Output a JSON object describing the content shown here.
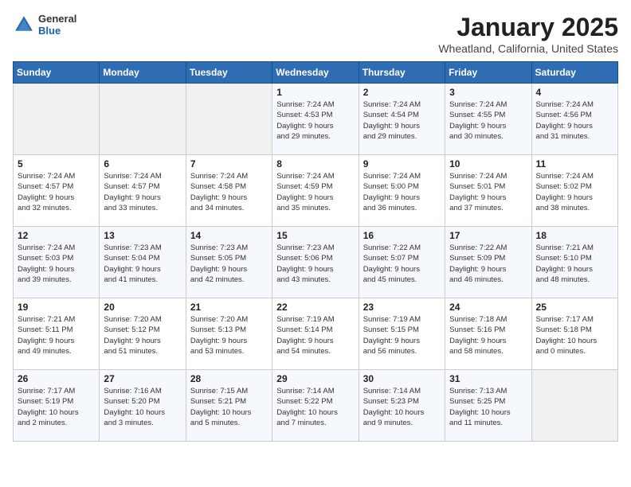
{
  "logo": {
    "general": "General",
    "blue": "Blue"
  },
  "header": {
    "title": "January 2025",
    "location": "Wheatland, California, United States"
  },
  "weekdays": [
    "Sunday",
    "Monday",
    "Tuesday",
    "Wednesday",
    "Thursday",
    "Friday",
    "Saturday"
  ],
  "weeks": [
    [
      {
        "day": "",
        "info": ""
      },
      {
        "day": "",
        "info": ""
      },
      {
        "day": "",
        "info": ""
      },
      {
        "day": "1",
        "info": "Sunrise: 7:24 AM\nSunset: 4:53 PM\nDaylight: 9 hours\nand 29 minutes."
      },
      {
        "day": "2",
        "info": "Sunrise: 7:24 AM\nSunset: 4:54 PM\nDaylight: 9 hours\nand 29 minutes."
      },
      {
        "day": "3",
        "info": "Sunrise: 7:24 AM\nSunset: 4:55 PM\nDaylight: 9 hours\nand 30 minutes."
      },
      {
        "day": "4",
        "info": "Sunrise: 7:24 AM\nSunset: 4:56 PM\nDaylight: 9 hours\nand 31 minutes."
      }
    ],
    [
      {
        "day": "5",
        "info": "Sunrise: 7:24 AM\nSunset: 4:57 PM\nDaylight: 9 hours\nand 32 minutes."
      },
      {
        "day": "6",
        "info": "Sunrise: 7:24 AM\nSunset: 4:57 PM\nDaylight: 9 hours\nand 33 minutes."
      },
      {
        "day": "7",
        "info": "Sunrise: 7:24 AM\nSunset: 4:58 PM\nDaylight: 9 hours\nand 34 minutes."
      },
      {
        "day": "8",
        "info": "Sunrise: 7:24 AM\nSunset: 4:59 PM\nDaylight: 9 hours\nand 35 minutes."
      },
      {
        "day": "9",
        "info": "Sunrise: 7:24 AM\nSunset: 5:00 PM\nDaylight: 9 hours\nand 36 minutes."
      },
      {
        "day": "10",
        "info": "Sunrise: 7:24 AM\nSunset: 5:01 PM\nDaylight: 9 hours\nand 37 minutes."
      },
      {
        "day": "11",
        "info": "Sunrise: 7:24 AM\nSunset: 5:02 PM\nDaylight: 9 hours\nand 38 minutes."
      }
    ],
    [
      {
        "day": "12",
        "info": "Sunrise: 7:24 AM\nSunset: 5:03 PM\nDaylight: 9 hours\nand 39 minutes."
      },
      {
        "day": "13",
        "info": "Sunrise: 7:23 AM\nSunset: 5:04 PM\nDaylight: 9 hours\nand 41 minutes."
      },
      {
        "day": "14",
        "info": "Sunrise: 7:23 AM\nSunset: 5:05 PM\nDaylight: 9 hours\nand 42 minutes."
      },
      {
        "day": "15",
        "info": "Sunrise: 7:23 AM\nSunset: 5:06 PM\nDaylight: 9 hours\nand 43 minutes."
      },
      {
        "day": "16",
        "info": "Sunrise: 7:22 AM\nSunset: 5:07 PM\nDaylight: 9 hours\nand 45 minutes."
      },
      {
        "day": "17",
        "info": "Sunrise: 7:22 AM\nSunset: 5:09 PM\nDaylight: 9 hours\nand 46 minutes."
      },
      {
        "day": "18",
        "info": "Sunrise: 7:21 AM\nSunset: 5:10 PM\nDaylight: 9 hours\nand 48 minutes."
      }
    ],
    [
      {
        "day": "19",
        "info": "Sunrise: 7:21 AM\nSunset: 5:11 PM\nDaylight: 9 hours\nand 49 minutes."
      },
      {
        "day": "20",
        "info": "Sunrise: 7:20 AM\nSunset: 5:12 PM\nDaylight: 9 hours\nand 51 minutes."
      },
      {
        "day": "21",
        "info": "Sunrise: 7:20 AM\nSunset: 5:13 PM\nDaylight: 9 hours\nand 53 minutes."
      },
      {
        "day": "22",
        "info": "Sunrise: 7:19 AM\nSunset: 5:14 PM\nDaylight: 9 hours\nand 54 minutes."
      },
      {
        "day": "23",
        "info": "Sunrise: 7:19 AM\nSunset: 5:15 PM\nDaylight: 9 hours\nand 56 minutes."
      },
      {
        "day": "24",
        "info": "Sunrise: 7:18 AM\nSunset: 5:16 PM\nDaylight: 9 hours\nand 58 minutes."
      },
      {
        "day": "25",
        "info": "Sunrise: 7:17 AM\nSunset: 5:18 PM\nDaylight: 10 hours\nand 0 minutes."
      }
    ],
    [
      {
        "day": "26",
        "info": "Sunrise: 7:17 AM\nSunset: 5:19 PM\nDaylight: 10 hours\nand 2 minutes."
      },
      {
        "day": "27",
        "info": "Sunrise: 7:16 AM\nSunset: 5:20 PM\nDaylight: 10 hours\nand 3 minutes."
      },
      {
        "day": "28",
        "info": "Sunrise: 7:15 AM\nSunset: 5:21 PM\nDaylight: 10 hours\nand 5 minutes."
      },
      {
        "day": "29",
        "info": "Sunrise: 7:14 AM\nSunset: 5:22 PM\nDaylight: 10 hours\nand 7 minutes."
      },
      {
        "day": "30",
        "info": "Sunrise: 7:14 AM\nSunset: 5:23 PM\nDaylight: 10 hours\nand 9 minutes."
      },
      {
        "day": "31",
        "info": "Sunrise: 7:13 AM\nSunset: 5:25 PM\nDaylight: 10 hours\nand 11 minutes."
      },
      {
        "day": "",
        "info": ""
      }
    ]
  ]
}
